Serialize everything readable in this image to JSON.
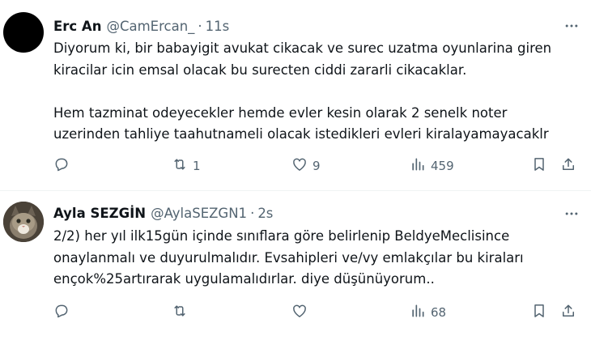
{
  "tweets": [
    {
      "name": "Erc An",
      "handle": "@CamErcan_",
      "separator": "·",
      "time": "11s",
      "lines": [
        "Diyorum ki, bir babayigit avukat cikacak ve surec uzatma oyunlarina giren",
        "kiracilar icin emsal olacak bu surecten ciddi zararli cikacaklar.",
        "",
        "Hem tazminat odeyecekler hemde evler kesin olarak 2 senelk noter",
        "uzerinden tahliye taahutnameli olacak istedikleri evleri kiralayamayacaklr"
      ],
      "replies": "",
      "retweets": "1",
      "likes": "9",
      "views": "459"
    },
    {
      "name": "Ayla SEZGİN",
      "handle": "@AylaSEZGN1",
      "separator": "·",
      "time": "2s",
      "lines": [
        "2/2) her yıl ilk15gün içinde sınıflara göre belirlenip BeldyeMeclisince",
        "onaylanmalı ve duyurulmalıdır. Evsahipleri ve/vy emlakçılar bu kiraları",
        "ençok%25artırarak uygulamalıdırlar. diye düşünüyorum.."
      ],
      "replies": "",
      "retweets": "",
      "likes": "",
      "views": "68"
    }
  ],
  "icons": {
    "more": "more-horizontal-icon",
    "reply": "reply-icon",
    "retweet": "retweet-icon",
    "like": "heart-icon",
    "views": "views-chart-icon",
    "bookmark": "bookmark-icon",
    "share": "share-icon"
  },
  "colors": {
    "text": "#0f1419",
    "secondary": "#536471",
    "divider": "#eff3f4"
  }
}
